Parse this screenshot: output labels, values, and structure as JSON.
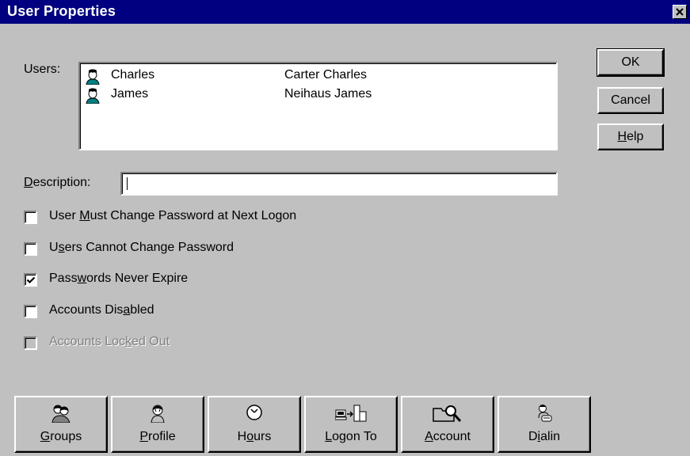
{
  "window": {
    "title": "User Properties",
    "close_glyph": "✕"
  },
  "users": {
    "label": "Users:",
    "rows": [
      {
        "name": "Charles",
        "full_name": "Carter Charles",
        "icon": "user-icon"
      },
      {
        "name": "James",
        "full_name": "Neihaus James",
        "icon": "user-icon"
      }
    ]
  },
  "side_buttons": {
    "ok": "OK",
    "cancel": "Cancel",
    "help_first": "H",
    "help_rest": "elp"
  },
  "description": {
    "label_first": "D",
    "label_rest": "escription:",
    "value": ""
  },
  "checkboxes": [
    {
      "pre": "User ",
      "acc": "M",
      "post": "ust Change Password at Next Logon",
      "checked": false,
      "disabled": false
    },
    {
      "pre": "U",
      "acc": "s",
      "post": "ers Cannot Change Password",
      "checked": false,
      "disabled": false
    },
    {
      "pre": "Pass",
      "acc": "w",
      "post": "ords Never Expire",
      "checked": true,
      "disabled": false
    },
    {
      "pre": "Accounts Dis",
      "acc": "a",
      "post": "bled",
      "checked": false,
      "disabled": false
    },
    {
      "pre": "Accounts Loc",
      "acc": "k",
      "post": "ed Out",
      "checked": false,
      "disabled": true
    }
  ],
  "bottom_buttons": [
    {
      "pre": "",
      "acc": "G",
      "post": "roups",
      "icon": "groups-icon"
    },
    {
      "pre": "",
      "acc": "P",
      "post": "rofile",
      "icon": "profile-icon"
    },
    {
      "pre": "H",
      "acc": "o",
      "post": "urs",
      "icon": "clock-icon"
    },
    {
      "pre": "",
      "acc": "L",
      "post": "ogon To",
      "icon": "logon-to-icon"
    },
    {
      "pre": "",
      "acc": "A",
      "post": "ccount",
      "icon": "account-icon"
    },
    {
      "pre": "D",
      "acc": "i",
      "post": "alin",
      "icon": "dialin-icon"
    }
  ],
  "colors": {
    "face": "#c0c0c0",
    "titlebar": "#000080",
    "window_bg": "#ffffff"
  }
}
